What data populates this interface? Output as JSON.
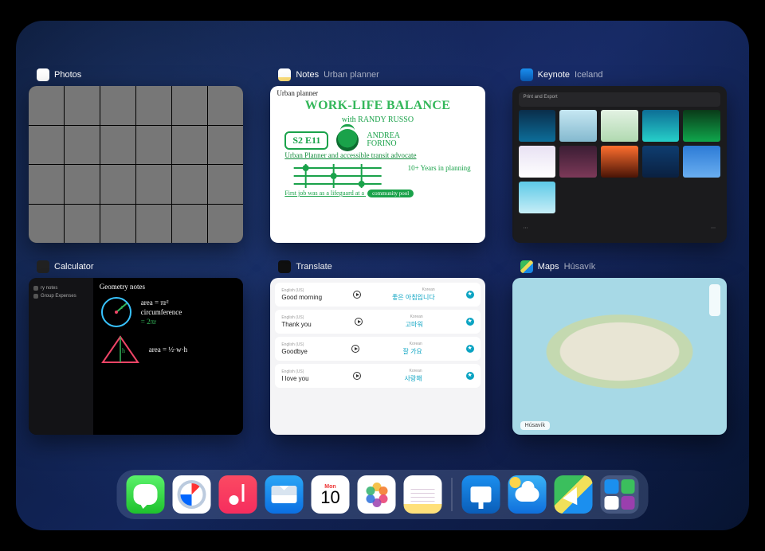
{
  "apps": {
    "photos": {
      "title": "Photos",
      "subtitle": ""
    },
    "notes": {
      "title": "Notes",
      "subtitle": "Urban planner",
      "doc_title": "Urban planner",
      "heading": "WORK-LIFE BALANCE",
      "heading_with": "with RANDY RUSSO",
      "episode": "S2 E11",
      "guest_first": "ANDREA",
      "guest_last": "FORINO",
      "tagline": "Urban Planner and accessible transit advocate",
      "years": "10+ Years in planning",
      "footer_a": "First job was as a lifeguard at a",
      "footer_pill": "community pool"
    },
    "keynote": {
      "title": "Keynote",
      "subtitle": "Iceland",
      "panel": "Print and Export"
    },
    "calculator": {
      "title": "Calculator",
      "subtitle": "",
      "note_title": "Geometry notes",
      "eq_area": "area = πr²",
      "eq_circ": "circumference",
      "eq_circ_val": "= 2πr",
      "eq_tri": "area = ½·w·h",
      "side_item1": "ry notes",
      "side_item2": "Group Expenses"
    },
    "translate": {
      "title": "Translate",
      "subtitle": "",
      "rows": [
        {
          "src_lang": "English (US)",
          "src": "Good morning",
          "dst_lang": "Korean",
          "dst": "좋은 아침입니다"
        },
        {
          "src_lang": "English (US)",
          "src": "Thank you",
          "dst_lang": "Korean",
          "dst": "고마워"
        },
        {
          "src_lang": "English (US)",
          "src": "Goodbye",
          "dst_lang": "Korean",
          "dst": "잘 가요"
        },
        {
          "src_lang": "English (US)",
          "src": "I love you",
          "dst_lang": "Korean",
          "dst": "사랑해"
        }
      ]
    },
    "maps": {
      "title": "Maps",
      "subtitle": "Húsavík",
      "label": "Húsavík"
    }
  },
  "dock": {
    "calendar_day": "Mon",
    "calendar_date": "10",
    "items": [
      "Messages",
      "Safari",
      "Music",
      "Mail",
      "Calendar",
      "Photos",
      "Notes",
      "Keynote",
      "Weather",
      "Maps",
      "App Library"
    ]
  }
}
